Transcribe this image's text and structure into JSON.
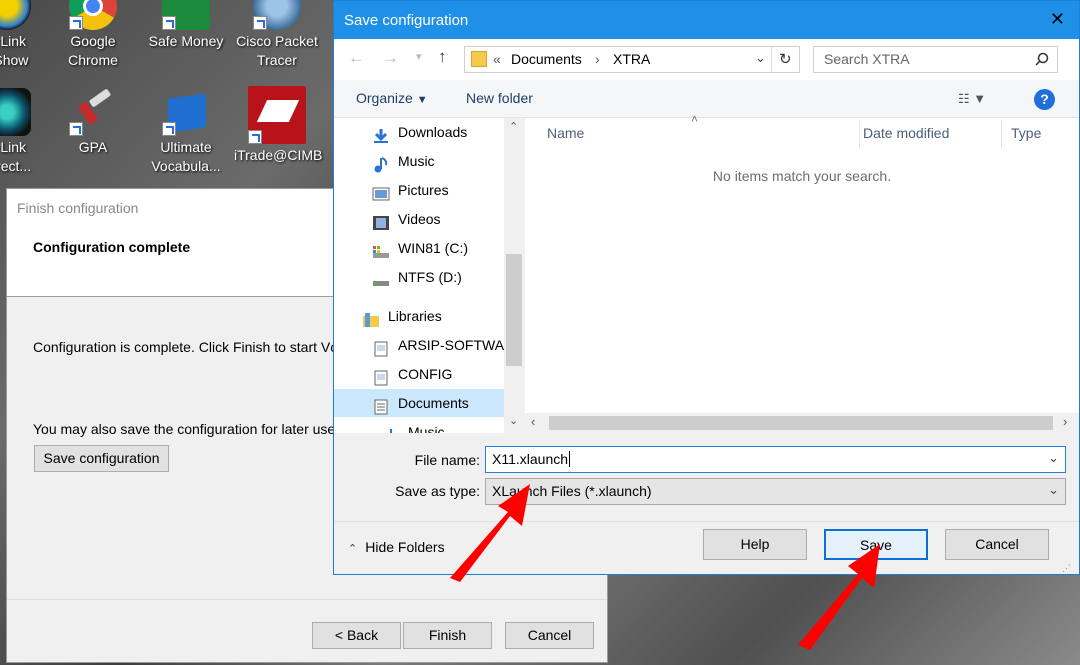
{
  "desktop": {
    "icons": [
      {
        "label1": "erLink",
        "label2": "aShow"
      },
      {
        "label1": "Google",
        "label2": "Chrome"
      },
      {
        "label1": "Safe Money",
        "label2": ""
      },
      {
        "label1": "Cisco Packet",
        "label2": "Tracer"
      },
      {
        "label1": "erLink",
        "label2": "Direct..."
      },
      {
        "label1": "GPA",
        "label2": ""
      },
      {
        "label1": "Ultimate",
        "label2": "Vocabula..."
      },
      {
        "label1": "iTrade@CIMB",
        "label2": ""
      }
    ]
  },
  "wizard": {
    "title": "Finish configuration",
    "header": "Configuration complete",
    "body_text": "Configuration is complete. Click Finish to start VcXsrv",
    "save_hint": "You may also save the configuration for later use.",
    "save_config_label": "Save configuration",
    "back_label": "< Back",
    "finish_label": "Finish",
    "cancel_label": "Cancel"
  },
  "save_dialog": {
    "title": "Save configuration",
    "close_glyph": "✕",
    "address": {
      "prefix": "«",
      "crumbs": [
        "Documents",
        "XTRA"
      ]
    },
    "search_placeholder": "Search XTRA",
    "organize_label": "Organize",
    "new_folder_label": "New folder",
    "nav_items": [
      {
        "label": "Downloads",
        "icon": "download-icon"
      },
      {
        "label": "Music",
        "icon": "music-icon"
      },
      {
        "label": "Pictures",
        "icon": "pictures-icon"
      },
      {
        "label": "Videos",
        "icon": "videos-icon"
      },
      {
        "label": "WIN81 (C:)",
        "icon": "drive-icon"
      },
      {
        "label": "NTFS (D:)",
        "icon": "drive-icon"
      },
      {
        "label": "Libraries",
        "icon": "library-icon"
      },
      {
        "label": "ARSIP-SOFTWARE",
        "icon": "library-icon"
      },
      {
        "label": "CONFIG",
        "icon": "library-icon"
      },
      {
        "label": "Documents",
        "icon": "documents-icon"
      },
      {
        "label": "Music",
        "icon": "music-icon"
      }
    ],
    "columns": {
      "name": "Name",
      "date": "Date modified",
      "type": "Type"
    },
    "empty_message": "No items match your search.",
    "file_name_label": "File name:",
    "file_name_value": "X11.xlaunch",
    "save_as_type_label": "Save as type:",
    "save_as_type_value": "XLaunch Files (*.xlaunch)",
    "hide_folders_label": "Hide Folders",
    "help_label": "Help",
    "save_label": "Save",
    "cancel_label": "Cancel"
  },
  "colors": {
    "titlebar": "#1e90e8",
    "annotation_arrow": "#ff0000",
    "selected_nav": "#cce8ff"
  }
}
